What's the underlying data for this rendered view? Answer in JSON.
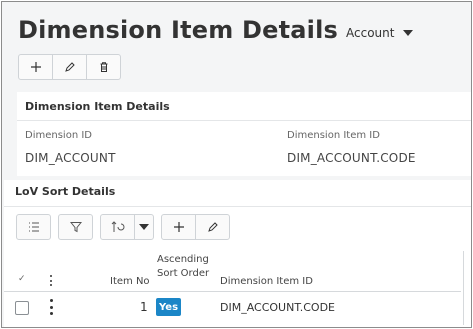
{
  "page": {
    "title": "Dimension Item Details",
    "context_selector": {
      "value": "Account",
      "icon": "caret-down-icon"
    }
  },
  "toolbar": {
    "buttons": [
      {
        "name": "new",
        "icon": "plus-icon"
      },
      {
        "name": "edit",
        "icon": "pencil-icon"
      },
      {
        "name": "delete",
        "icon": "trash-icon"
      }
    ]
  },
  "details": {
    "header": "Dimension Item Details",
    "fields": [
      {
        "label": "Dimension ID",
        "value": "DIM_ACCOUNT"
      },
      {
        "label": "Dimension Item ID",
        "value": "DIM_ACCOUNT.CODE"
      }
    ]
  },
  "lov": {
    "title": "LoV Sort Details",
    "tools": [
      {
        "name": "column-chooser",
        "icon": "list-icon"
      },
      {
        "name": "filter",
        "icon": "funnel-icon"
      },
      {
        "name": "sort",
        "icon": "sort-icon"
      },
      {
        "name": "sort-menu",
        "icon": "caret-down-icon"
      },
      {
        "name": "new",
        "icon": "plus-icon"
      },
      {
        "name": "edit",
        "icon": "pencil-icon"
      }
    ],
    "columns": {
      "check": "✓",
      "item_no": "Item No",
      "ascending_line1": "Ascending",
      "ascending_line2": "Sort Order",
      "dimension_item_id": "Dimension Item ID"
    },
    "rows": [
      {
        "item_no": "1",
        "ascending": "Yes",
        "dimension_item_id": "DIM_ACCOUNT.CODE"
      }
    ]
  },
  "colors": {
    "accent": "#1b86c7",
    "background": "#f4f5f6",
    "border": "#cfd3d7"
  }
}
